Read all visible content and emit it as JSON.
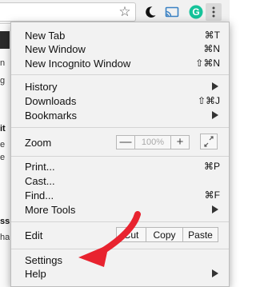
{
  "toolbar": {
    "icons": [
      "star-icon",
      "moon-icon",
      "cast-icon",
      "grammarly-icon",
      "kebab-menu-icon"
    ],
    "grammarly_letter": "G"
  },
  "page": {
    "fragments": [
      {
        "text": "n",
        "bold": false
      },
      {
        "text": "g",
        "bold": false
      },
      {
        "text": "it",
        "bold": true
      },
      {
        "text": "e",
        "bold": false
      },
      {
        "text": "e",
        "bold": false
      },
      {
        "text": "ss",
        "bold": true
      },
      {
        "text": "ha",
        "bold": false
      }
    ]
  },
  "menu": {
    "new_tab": {
      "label": "New Tab",
      "shortcut": "⌘T"
    },
    "new_window": {
      "label": "New Window",
      "shortcut": "⌘N"
    },
    "new_incognito": {
      "label": "New Incognito Window",
      "shortcut": "⇧⌘N"
    },
    "history": {
      "label": "History"
    },
    "downloads": {
      "label": "Downloads",
      "shortcut": "⇧⌘J"
    },
    "bookmarks": {
      "label": "Bookmarks"
    },
    "zoom": {
      "label": "Zoom",
      "minus": "—",
      "value": "100%",
      "plus": "+"
    },
    "print": {
      "label": "Print...",
      "shortcut": "⌘P"
    },
    "cast": {
      "label": "Cast..."
    },
    "find": {
      "label": "Find...",
      "shortcut": "⌘F"
    },
    "more_tools": {
      "label": "More Tools"
    },
    "edit": {
      "label": "Edit",
      "cut": "Cut",
      "copy": "Copy",
      "paste": "Paste"
    },
    "settings": {
      "label": "Settings"
    },
    "help": {
      "label": "Help"
    }
  },
  "colors": {
    "annotation_arrow": "#e8232f",
    "menu_background": "#f2f2f2",
    "cast_icon": "#3b82c4",
    "grammarly": "#15c39a"
  }
}
